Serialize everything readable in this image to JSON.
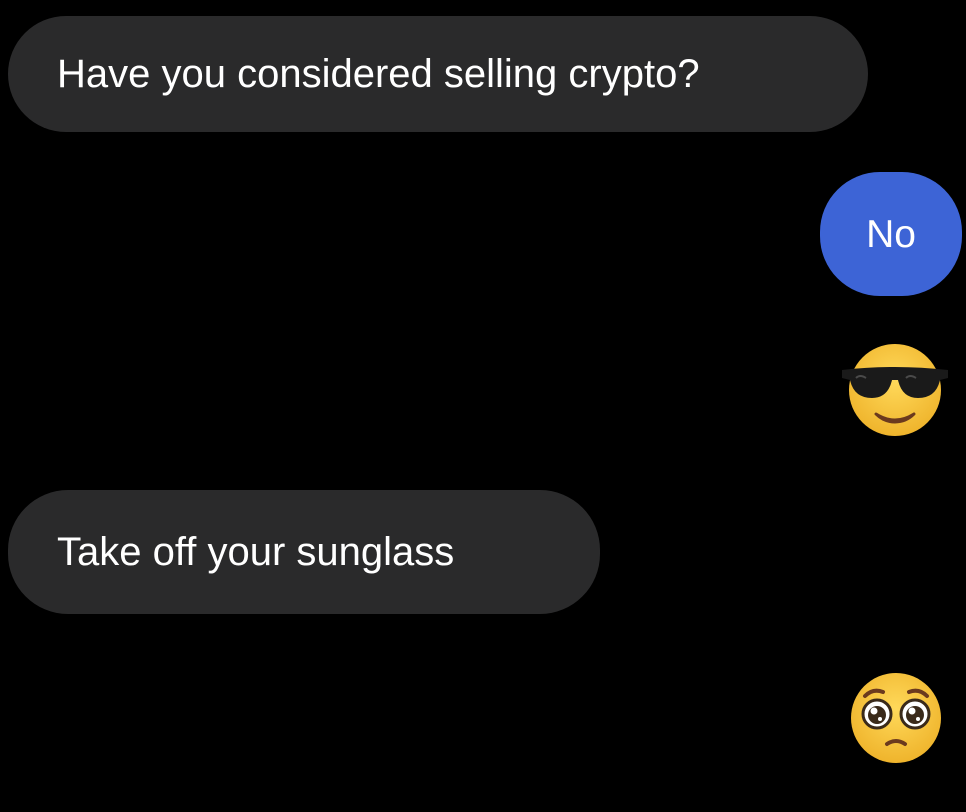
{
  "conversation": {
    "messages": [
      {
        "sender": "them",
        "type": "text",
        "text": "Have you considered selling crypto?"
      },
      {
        "sender": "me",
        "type": "text",
        "text": "No"
      },
      {
        "sender": "me",
        "type": "emoji",
        "icon": "sunglasses-smiling-face-icon"
      },
      {
        "sender": "them",
        "type": "text",
        "text": "Take off your sunglass"
      },
      {
        "sender": "me",
        "type": "emoji",
        "icon": "pleading-face-icon"
      }
    ]
  },
  "colors": {
    "background": "#000000",
    "incoming_bubble": "#2a2a2b",
    "outgoing_bubble": "#3d64d6",
    "text": "#ffffff",
    "emoji_face": "#f7c53f"
  }
}
